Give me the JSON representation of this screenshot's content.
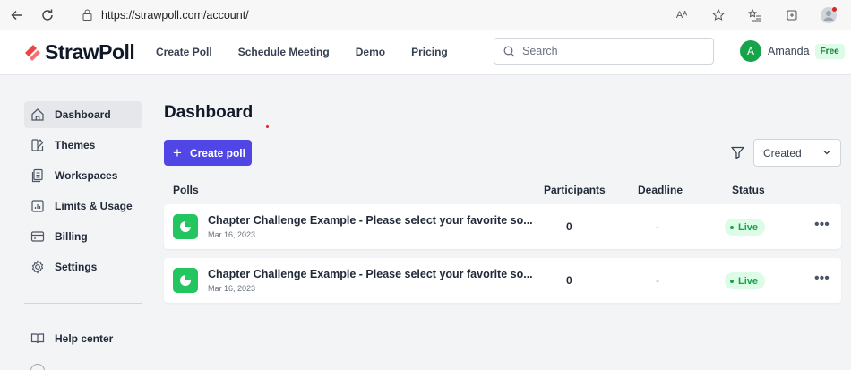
{
  "browser": {
    "url": "https://strawpoll.com/account/",
    "icons": [
      "back-icon",
      "refresh-icon",
      "lock-icon",
      "read-aloud-icon",
      "favorite-icon",
      "favorites-list-icon",
      "collections-icon",
      "profile-icon"
    ],
    "read_aloud_text": "Aᴬ"
  },
  "header": {
    "logo_text": "StrawPoll",
    "nav": [
      "Create Poll",
      "Schedule Meeting",
      "Demo",
      "Pricing"
    ],
    "search_placeholder": "Search",
    "user": {
      "initial": "A",
      "name": "Amanda",
      "plan": "Free"
    }
  },
  "sidebar": {
    "items": [
      {
        "label": "Dashboard",
        "icon": "home-icon",
        "active": true
      },
      {
        "label": "Themes",
        "icon": "palette-icon",
        "active": false
      },
      {
        "label": "Workspaces",
        "icon": "workspaces-icon",
        "active": false
      },
      {
        "label": "Limits & Usage",
        "icon": "chart-icon",
        "active": false
      },
      {
        "label": "Billing",
        "icon": "credit-card-icon",
        "active": false
      },
      {
        "label": "Settings",
        "icon": "gear-icon",
        "active": false
      }
    ],
    "help_label": "Help center"
  },
  "main": {
    "title": "Dashboard",
    "create_button": "Create poll",
    "sort_value": "Created",
    "columns": [
      "Polls",
      "Participants",
      "Deadline",
      "Status"
    ],
    "rows": [
      {
        "title": "Chapter Challenge Example - Please select your favorite so...",
        "date": "Mar 16, 2023",
        "participants": "0",
        "deadline": "-",
        "status": "Live"
      },
      {
        "title": "Chapter Challenge Example - Please select your favorite so...",
        "date": "Mar 16, 2023",
        "participants": "0",
        "deadline": "-",
        "status": "Live"
      }
    ],
    "more_label": "•••"
  },
  "colors": {
    "accent": "#4f46e5",
    "live": "#16a34a",
    "poll_icon": "#22c55e",
    "logo_mark": "#ef4444"
  }
}
